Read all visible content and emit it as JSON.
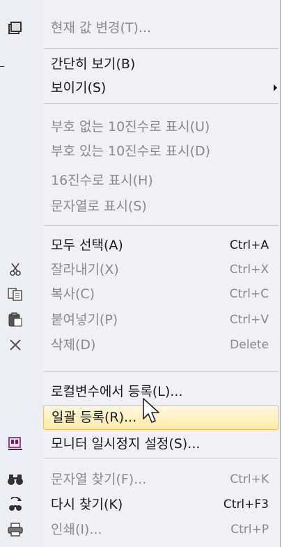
{
  "menu": {
    "items": [
      {
        "label": "현재 값 변경(T)...",
        "shortcut": "",
        "icon": "edit-value-icon",
        "enabled": false
      },
      {
        "label": "간단히 보기(B)",
        "shortcut": "",
        "icon": "",
        "enabled": true
      },
      {
        "label": "보이기(S)",
        "shortcut": "",
        "icon": "",
        "enabled": true,
        "submenu": true
      },
      {
        "label": "부호 없는 10진수로 표시(U)",
        "shortcut": "",
        "icon": "",
        "enabled": false
      },
      {
        "label": "부호 있는 10진수로 표시(D)",
        "shortcut": "",
        "icon": "",
        "enabled": false
      },
      {
        "label": "16진수로 표시(H)",
        "shortcut": "",
        "icon": "",
        "enabled": false
      },
      {
        "label": "문자열로 표시(S)",
        "shortcut": "",
        "icon": "",
        "enabled": false
      },
      {
        "label": "모두 선택(A)",
        "shortcut": "Ctrl+A",
        "icon": "",
        "enabled": true
      },
      {
        "label": "잘라내기(X)",
        "shortcut": "Ctrl+X",
        "icon": "scissors-icon",
        "enabled": false
      },
      {
        "label": "복사(C)",
        "shortcut": "Ctrl+C",
        "icon": "copy-icon",
        "enabled": false
      },
      {
        "label": "붙여넣기(P)",
        "shortcut": "Ctrl+V",
        "icon": "paste-icon",
        "enabled": false
      },
      {
        "label": "삭제(D)",
        "shortcut": "Delete",
        "icon": "delete-x-icon",
        "enabled": false
      },
      {
        "label": "로컬변수에서 등록(L)...",
        "shortcut": "",
        "icon": "",
        "enabled": true
      },
      {
        "label": "일괄 등록(R)...",
        "shortcut": "",
        "icon": "",
        "enabled": true,
        "highlighted": true
      },
      {
        "label": "모니터 일시정지 설정(S)...",
        "shortcut": "",
        "icon": "monitor-pause-icon",
        "enabled": true
      },
      {
        "label": "문자열 찾기(F)...",
        "shortcut": "Ctrl+K",
        "icon": "binoculars-icon",
        "enabled": false
      },
      {
        "label": "다시 찾기(K)",
        "shortcut": "Ctrl+F3",
        "icon": "find-again-icon",
        "enabled": true
      },
      {
        "label": "인쇄(I)...",
        "shortcut": "Ctrl+P",
        "icon": "printer-icon",
        "enabled": false
      }
    ]
  },
  "colors": {
    "highlight_border": "#e5c365",
    "highlight_fill": "#ffeaa8",
    "disabled_text": "#8a8a8a",
    "enabled_text": "#1a1a1a"
  }
}
